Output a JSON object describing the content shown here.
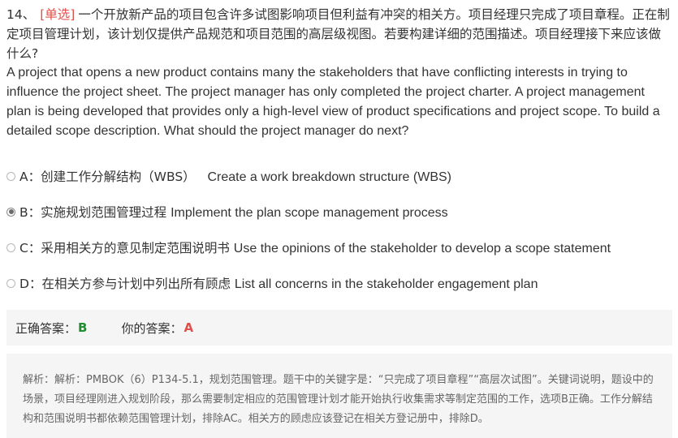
{
  "question": {
    "number": "14、",
    "type_label": "[单选]",
    "text_cn": "一个开放新产品的项目包含许多试图影响项目但利益有冲突的相关方。项目经理只完成了项目章程。正在制定项目管理计划，该计划仅提供产品规范和项目范围的高层级视图。若要构建详细的范围描述。项目经理接下来应该做什么?",
    "text_en": "A project that opens a new product contains many the stakeholders that have conflicting interests in trying to influence the project sheet. The project manager has only completed the project charter. A project management plan is being developed that provides only a high-level view of product specifications and project scope. To build a detailed scope description. What should the project manager do next?"
  },
  "options": [
    {
      "letter": "A",
      "cn": "创建工作分解结构（WBS）",
      "en": "Create a work breakdown structure (WBS)",
      "selected": false
    },
    {
      "letter": "B",
      "cn": "实施规划范围管理过程",
      "en": "Implement the plan scope management process",
      "selected": true
    },
    {
      "letter": "C",
      "cn": "采用相关方的意见制定范围说明书",
      "en": "Use the opinions of the stakeholder to develop a scope statement",
      "selected": false
    },
    {
      "letter": "D",
      "cn": "在相关方参与计划中列出所有顾虑",
      "en": "List all concerns in the stakeholder engagement plan",
      "selected": false
    }
  ],
  "answer": {
    "correct_label": "正确答案：",
    "correct_value": "B",
    "user_label": "你的答案：",
    "user_value": "A"
  },
  "analysis": {
    "text": "解析：解析：PMBOK（6）P134-5.1，规划范围管理。题干中的关键字是：“只完成了项目章程”“高层次试图”。关键词说明，题设中的场景，项目经理刚进入规划阶段，那么需要制定相应的范围管理计划才能开始执行收集需求等制定范围的工作，选项B正确。工作分解结构和范围说明书都依赖范围管理计划，排除AC。相关方的顾虑应该登记在相关方登记册中，排除D。"
  },
  "colors": {
    "type_label": "#e0504a",
    "correct": "#1e8f2e",
    "wrong": "#e0504a",
    "panel_bg": "#f5f5f5"
  }
}
